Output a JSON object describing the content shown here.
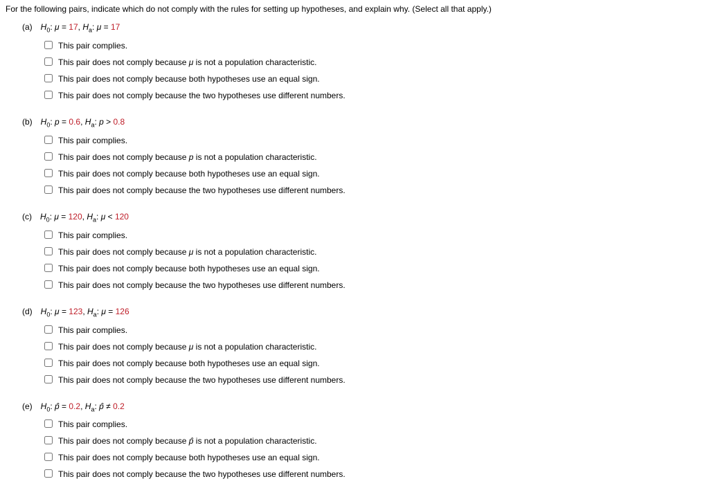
{
  "instructions": "For the following pairs, indicate which do not comply with the rules for setting up hypotheses, and explain why. (Select all that apply.)",
  "parts": [
    {
      "label": "(a)",
      "hyp": {
        "H0_sym": "μ",
        "H0_rel": "=",
        "H0_val": "17",
        "Ha_sym": "μ",
        "Ha_rel": "=",
        "Ha_val": "17"
      },
      "symLabel": "μ",
      "opt": [
        "This pair complies.",
        "This pair does not comply because {sym} is not a population characteristic.",
        "This pair does not comply because both hypotheses use an equal sign.",
        "This pair does not comply because the two hypotheses use different numbers."
      ]
    },
    {
      "label": "(b)",
      "hyp": {
        "H0_sym": "p",
        "H0_rel": "=",
        "H0_val": "0.6",
        "Ha_sym": "p",
        "Ha_rel": ">",
        "Ha_val": "0.8"
      },
      "symLabel": "p",
      "opt": [
        "This pair complies.",
        "This pair does not comply because {sym} is not a population characteristic.",
        "This pair does not comply because both hypotheses use an equal sign.",
        "This pair does not comply because the two hypotheses use different numbers."
      ]
    },
    {
      "label": "(c)",
      "hyp": {
        "H0_sym": "μ",
        "H0_rel": "=",
        "H0_val": "120",
        "Ha_sym": "μ",
        "Ha_rel": "<",
        "Ha_val": "120"
      },
      "symLabel": "μ",
      "opt": [
        "This pair complies.",
        "This pair does not comply because {sym} is not a population characteristic.",
        "This pair does not comply because both hypotheses use an equal sign.",
        "This pair does not comply because the two hypotheses use different numbers."
      ]
    },
    {
      "label": "(d)",
      "hyp": {
        "H0_sym": "μ",
        "H0_rel": "=",
        "H0_val": "123",
        "Ha_sym": "μ",
        "Ha_rel": "=",
        "Ha_val": "126"
      },
      "symLabel": "μ",
      "opt": [
        "This pair complies.",
        "This pair does not comply because {sym} is not a population characteristic.",
        "This pair does not comply because both hypotheses use an equal sign.",
        "This pair does not comply because the two hypotheses use different numbers."
      ]
    },
    {
      "label": "(e)",
      "hyp": {
        "H0_sym": "p̂",
        "H0_rel": "=",
        "H0_val": "0.2",
        "Ha_sym": "p̂",
        "Ha_rel": "≠",
        "Ha_val": "0.2"
      },
      "symLabel": "p̂",
      "opt": [
        "This pair complies.",
        "This pair does not comply because {sym} is not a population characteristic.",
        "This pair does not comply because both hypotheses use an equal sign.",
        "This pair does not comply because the two hypotheses use different numbers."
      ]
    }
  ]
}
